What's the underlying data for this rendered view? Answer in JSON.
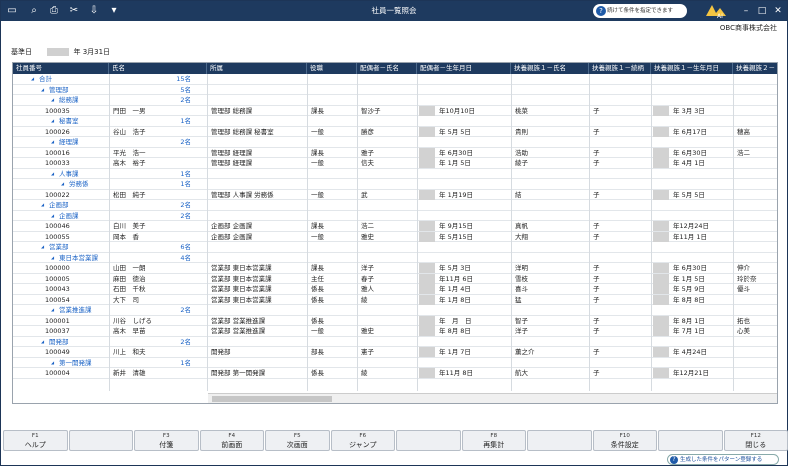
{
  "window": {
    "title": "社員一覧照会"
  },
  "toolbar": {
    "condition_button": "続けて条件を指定できます"
  },
  "company": "OBC商事株式会社",
  "ref_date": {
    "label": "基準日",
    "value": "年 3月31日"
  },
  "columns": [
    "社員番号",
    "氏名",
    "所属",
    "役職",
    "配偶者－氏名",
    "配偶者－生年月日",
    "扶養親族１－氏名",
    "扶養親族１－続柄",
    "扶養親族１－生年月日",
    "扶養親族２－"
  ],
  "rows": [
    {
      "type": "group",
      "level": 0,
      "label": "合計",
      "count": "15名"
    },
    {
      "type": "group",
      "level": 1,
      "label": "管理部",
      "count": "5名"
    },
    {
      "type": "group",
      "level": 2,
      "label": "総務課",
      "count": "2名"
    },
    {
      "type": "emp",
      "no": "100035",
      "name": "門田　一男",
      "dept": "管理部 総務課",
      "pos": "課長",
      "sp": "智沙子",
      "spd": "年10月10日",
      "d1": "桃菜",
      "r1": "子",
      "d1d": "年 3月 3日",
      "d2": ""
    },
    {
      "type": "group",
      "level": 2,
      "label": "秘書室",
      "count": "1名"
    },
    {
      "type": "emp",
      "no": "100026",
      "name": "谷山　浩子",
      "dept": "管理部 総務課 秘書室",
      "pos": "一般",
      "sp": "勝彦",
      "spd": "年 5月 5日",
      "d1": "貴則",
      "r1": "子",
      "d1d": "年 6月17日",
      "d2": "穂高"
    },
    {
      "type": "group",
      "level": 2,
      "label": "経理課",
      "count": "2名"
    },
    {
      "type": "emp",
      "no": "100016",
      "name": "平光　浩一",
      "dept": "管理部 経理課",
      "pos": "課長",
      "sp": "雅子",
      "spd": "年 6月30日",
      "d1": "浩助",
      "r1": "子",
      "d1d": "年 6月30日",
      "d2": "浩二"
    },
    {
      "type": "emp",
      "no": "100033",
      "name": "高木　裕子",
      "dept": "管理部 経理課",
      "pos": "一般",
      "sp": "信夫",
      "spd": "年 1月 5日",
      "d1": "綾子",
      "r1": "子",
      "d1d": "年 4月 1日",
      "d2": ""
    },
    {
      "type": "group",
      "level": 2,
      "label": "人事課",
      "count": "1名"
    },
    {
      "type": "group",
      "level": 3,
      "label": "労務係",
      "count": "1名"
    },
    {
      "type": "emp",
      "no": "100022",
      "name": "松田　純子",
      "dept": "管理部 人事課 労務係",
      "pos": "一般",
      "sp": "武",
      "spd": "年 1月19日",
      "d1": "結",
      "r1": "子",
      "d1d": "年 5月 5日",
      "d2": ""
    },
    {
      "type": "group",
      "level": 1,
      "label": "企画部",
      "count": "2名"
    },
    {
      "type": "group",
      "level": 2,
      "label": "企画課",
      "count": "2名"
    },
    {
      "type": "emp",
      "no": "100046",
      "name": "白川　美子",
      "dept": "企画部 企画課",
      "pos": "課長",
      "sp": "浩二",
      "spd": "年 9月15日",
      "d1": "真帆",
      "r1": "子",
      "d1d": "年12月24日",
      "d2": ""
    },
    {
      "type": "emp",
      "no": "100055",
      "name": "岡本　香",
      "dept": "企画部 企画課",
      "pos": "一般",
      "sp": "雅史",
      "spd": "年 5月15日",
      "d1": "大翔",
      "r1": "子",
      "d1d": "年11月 1日",
      "d2": ""
    },
    {
      "type": "group",
      "level": 1,
      "label": "営業部",
      "count": "6名"
    },
    {
      "type": "group",
      "level": 2,
      "label": "東日本営業課",
      "count": "4名"
    },
    {
      "type": "emp",
      "no": "100000",
      "name": "山田　一朗",
      "dept": "営業部 東日本営業課",
      "pos": "課長",
      "sp": "洋子",
      "spd": "年 5月 3日",
      "d1": "洋明",
      "r1": "子",
      "d1d": "年 6月30日",
      "d2": "伸介"
    },
    {
      "type": "emp",
      "no": "100005",
      "name": "麻田　徳治",
      "dept": "営業部 東日本営業課",
      "pos": "主任",
      "sp": "春子",
      "spd": "年11月 6日",
      "d1": "雪枝",
      "r1": "子",
      "d1d": "年 1月 5日",
      "d2": "玲於奈"
    },
    {
      "type": "emp",
      "no": "100043",
      "name": "石田　千秋",
      "dept": "営業部 東日本営業課",
      "pos": "係長",
      "sp": "雅人",
      "spd": "年 1月 4日",
      "d1": "喜斗",
      "r1": "子",
      "d1d": "年 5月 9日",
      "d2": "優斗"
    },
    {
      "type": "emp",
      "no": "100054",
      "name": "大下　司",
      "dept": "営業部 東日本営業課",
      "pos": "係長",
      "sp": "綾",
      "spd": "年 1月 8日",
      "d1": "猛",
      "r1": "子",
      "d1d": "年 8月 8日",
      "d2": ""
    },
    {
      "type": "group",
      "level": 2,
      "label": "営業推進課",
      "count": "2名"
    },
    {
      "type": "emp",
      "no": "100001",
      "name": "川谷　しげる",
      "dept": "営業部 営業推進課",
      "pos": "係長",
      "sp": "",
      "spd": "年　月　日",
      "d1": "智子",
      "r1": "子",
      "d1d": "年 8月 1日",
      "d2": "拓也"
    },
    {
      "type": "emp",
      "no": "100037",
      "name": "高木　早苗",
      "dept": "営業部 営業推進課",
      "pos": "一般",
      "sp": "雅史",
      "spd": "年 8月 8日",
      "d1": "洋子",
      "r1": "子",
      "d1d": "年 7月 1日",
      "d2": "心美"
    },
    {
      "type": "group",
      "level": 1,
      "label": "開発部",
      "count": "2名"
    },
    {
      "type": "emp",
      "no": "100049",
      "name": "川上　和夫",
      "dept": "開発部",
      "pos": "部長",
      "sp": "憲子",
      "spd": "年 1月 7日",
      "d1": "薫之介",
      "r1": "子",
      "d1d": "年 4月24日",
      "d2": ""
    },
    {
      "type": "group",
      "level": 2,
      "label": "第一開発課",
      "count": "1名"
    },
    {
      "type": "emp",
      "no": "100004",
      "name": "新井　清雄",
      "dept": "開発部 第一開発課",
      "pos": "係長",
      "sp": "綾",
      "spd": "年11月 8日",
      "d1": "航大",
      "r1": "子",
      "d1d": "年12月21日",
      "d2": ""
    }
  ],
  "fkeys": [
    {
      "key": "F1",
      "label": "ヘルプ"
    },
    {
      "key": "",
      "label": ""
    },
    {
      "key": "F3",
      "label": "付箋"
    },
    {
      "key": "F4",
      "label": "前画面"
    },
    {
      "key": "F5",
      "label": "次画面"
    },
    {
      "key": "F6",
      "label": "ジャンプ"
    },
    {
      "key": "",
      "label": ""
    },
    {
      "key": "F8",
      "label": "再集計"
    },
    {
      "key": "",
      "label": ""
    },
    {
      "key": "F10",
      "label": "条件設定"
    },
    {
      "key": "",
      "label": ""
    },
    {
      "key": "F12",
      "label": "閉じる"
    }
  ],
  "save_pattern_link": "生成した条件をパターン登録する"
}
